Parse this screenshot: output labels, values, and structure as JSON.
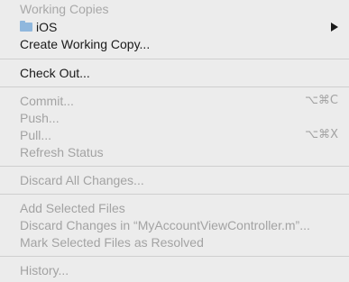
{
  "menu": {
    "working_copies_header": "Working Copies",
    "ios_item": {
      "label": "iOS",
      "icon": "folder-icon",
      "icon_color": "#8fb7dd"
    },
    "create_working_copy": "Create Working Copy...",
    "check_out": "Check Out...",
    "commit": {
      "label": "Commit...",
      "shortcut": "⌥⌘C"
    },
    "push": "Push...",
    "pull": {
      "label": "Pull...",
      "shortcut": "⌥⌘X"
    },
    "refresh_status": "Refresh Status",
    "discard_all": "Discard All Changes...",
    "add_selected": "Add Selected Files",
    "discard_changes_in": "Discard Changes in “MyAccountViewController.m”...",
    "mark_resolved": "Mark Selected Files as Resolved",
    "history": "History..."
  }
}
